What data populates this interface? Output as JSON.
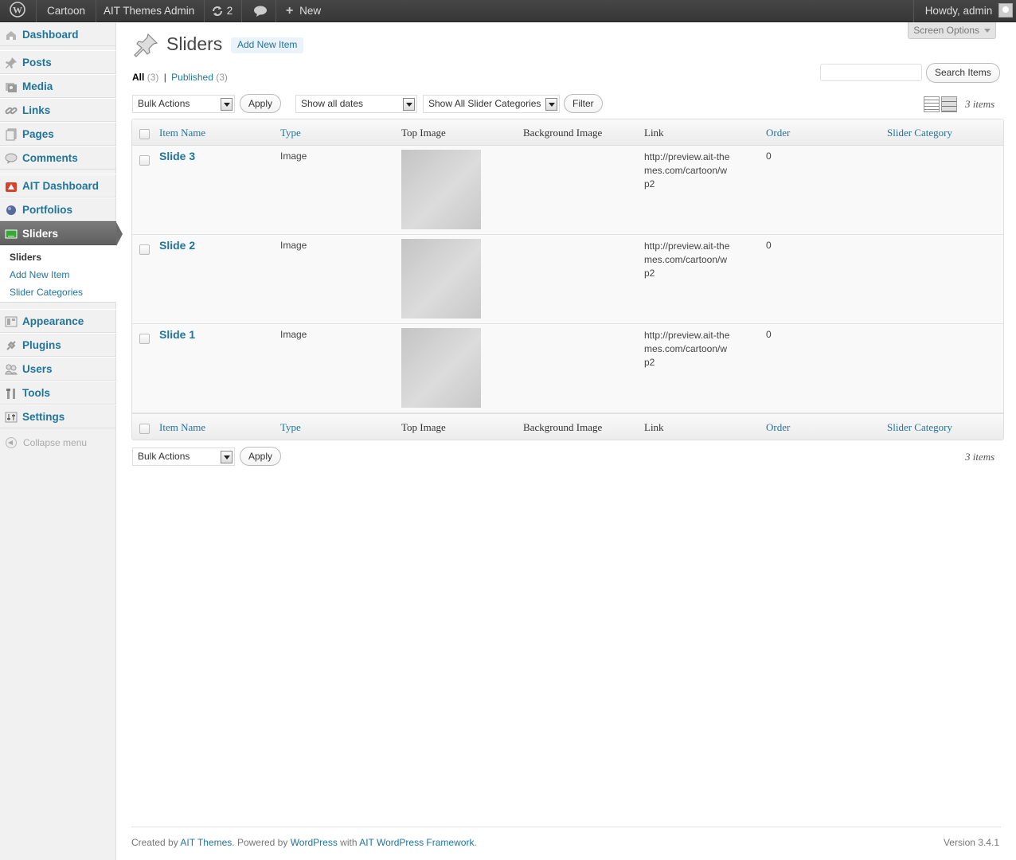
{
  "adminbar": {
    "site_name": "Cartoon",
    "theme_admin": "AIT Themes Admin",
    "updates_count": "2",
    "new_label": "New",
    "greeting": "Howdy, admin"
  },
  "sidebar": {
    "items": [
      {
        "label": "Dashboard",
        "icon": "dashboard-icon"
      },
      {
        "label": "Posts",
        "icon": "pin-icon"
      },
      {
        "label": "Media",
        "icon": "media-icon"
      },
      {
        "label": "Links",
        "icon": "link-icon"
      },
      {
        "label": "Pages",
        "icon": "page-icon"
      },
      {
        "label": "Comments",
        "icon": "comment-icon"
      },
      {
        "label": "AIT Dashboard",
        "icon": "ait-icon"
      },
      {
        "label": "Portfolios",
        "icon": "portfolio-icon"
      },
      {
        "label": "Sliders",
        "icon": "slider-icon"
      },
      {
        "label": "Appearance",
        "icon": "appearance-icon"
      },
      {
        "label": "Plugins",
        "icon": "plugin-icon"
      },
      {
        "label": "Users",
        "icon": "users-icon"
      },
      {
        "label": "Tools",
        "icon": "tools-icon"
      },
      {
        "label": "Settings",
        "icon": "settings-icon"
      }
    ],
    "submenu": [
      "Sliders",
      "Add New Item",
      "Slider Categories"
    ],
    "collapse_label": "Collapse menu"
  },
  "header": {
    "screen_options": "Screen Options",
    "title": "Sliders",
    "add_new": "Add New Item"
  },
  "filters": {
    "all_label": "All",
    "all_count": "(3)",
    "published_label": "Published",
    "published_count": "(3)",
    "search_button": "Search Items",
    "bulk_actions": "Bulk Actions",
    "apply": "Apply",
    "dates": "Show all dates",
    "categories": "Show All Slider Categories",
    "filter": "Filter",
    "items_count": "3 items"
  },
  "table": {
    "columns": [
      "Item Name",
      "Type",
      "Top Image",
      "Background Image",
      "Link",
      "Order",
      "Slider Category"
    ],
    "rows": [
      {
        "name": "Slide 3",
        "type": "Image",
        "link": "http://preview.ait-themes.com/cartoon/wp2",
        "order": "0"
      },
      {
        "name": "Slide 2",
        "type": "Image",
        "link": "http://preview.ait-themes.com/cartoon/wp2",
        "order": "0"
      },
      {
        "name": "Slide 1",
        "type": "Image",
        "link": "http://preview.ait-themes.com/cartoon/wp2",
        "order": "0"
      }
    ]
  },
  "footer": {
    "created_by": "Created by",
    "ait_themes": "AIT Themes",
    "powered_by": ". Powered by",
    "wordpress": "WordPress",
    "with": "with",
    "framework": "AIT WordPress Framework",
    "period": ".",
    "version": "Version 3.4.1"
  },
  "colors": {
    "link": "#21759b",
    "adminbar": "#464646",
    "current_menu": "#6a6a6a"
  }
}
